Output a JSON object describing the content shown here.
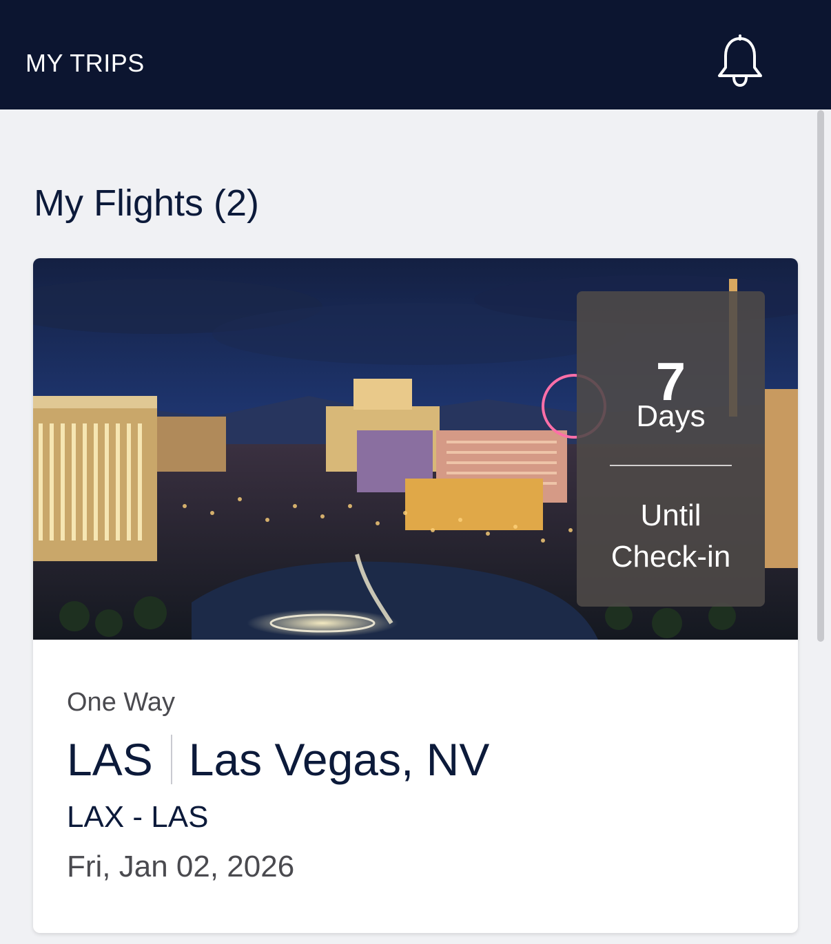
{
  "header": {
    "title": "MY TRIPS",
    "notification_icon": "bell-icon"
  },
  "section": {
    "title": "My Flights (2)"
  },
  "flight_card": {
    "image_alt": "Las Vegas Strip at night",
    "countdown": {
      "value": "7",
      "unit": "Days",
      "label": "Until Check-in"
    },
    "trip_type": "One Way",
    "destination_code": "LAS",
    "destination_city": "Las Vegas, NV",
    "route": "LAX - LAS",
    "date": "Fri, Jan 02, 2026"
  },
  "colors": {
    "header_bg": "#0c1530",
    "page_bg": "#f0f1f4",
    "primary_text": "#0c1a3a",
    "secondary_text": "#4a4a4f"
  }
}
